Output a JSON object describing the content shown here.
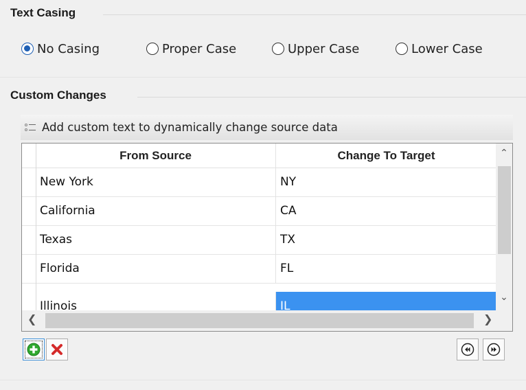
{
  "text_casing": {
    "title": "Text Casing",
    "options": [
      {
        "label": "No Casing",
        "checked": true
      },
      {
        "label": "Proper Case",
        "checked": false
      },
      {
        "label": "Upper Case",
        "checked": false
      },
      {
        "label": "Lower Case",
        "checked": false
      }
    ]
  },
  "custom_changes": {
    "title": "Custom Changes",
    "hint": "Add custom text to dynamically change source data",
    "columns": [
      "From Source",
      "Change To Target"
    ],
    "rows": [
      {
        "source": "New York",
        "target": "NY"
      },
      {
        "source": "California",
        "target": "CA"
      },
      {
        "source": "Texas",
        "target": "TX"
      },
      {
        "source": "Florida",
        "target": "FL"
      },
      {
        "source": "Illinois",
        "target": "IL"
      }
    ],
    "selected_row": 4,
    "buttons": {
      "add": "add-icon",
      "delete": "delete-icon",
      "prev": "previous-icon",
      "next": "next-icon"
    }
  },
  "colors": {
    "selection": "#3b92f0",
    "radio_checked": "#1e5fb4",
    "add_green": "#2fa82f",
    "delete_red": "#d42a2a"
  }
}
